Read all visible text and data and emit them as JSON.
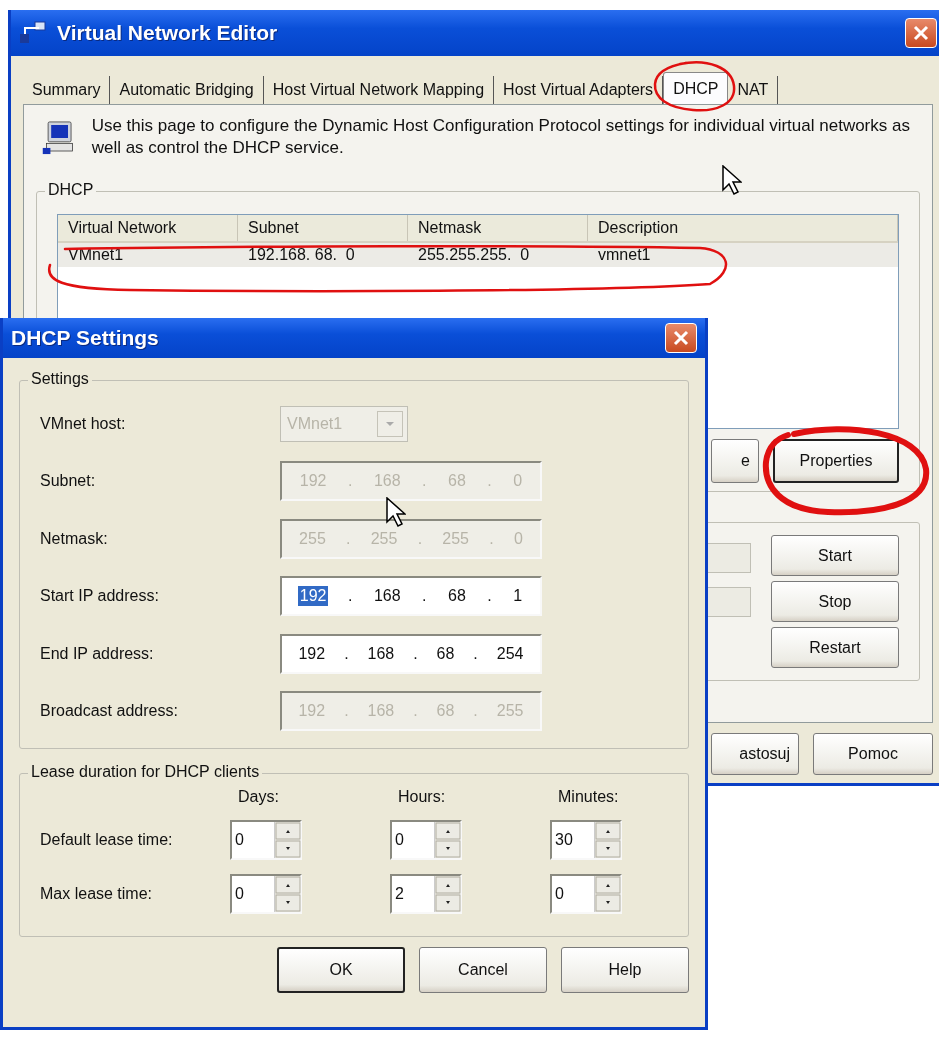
{
  "main_window": {
    "title": "Virtual Network Editor",
    "tabs": [
      {
        "label": "Summary",
        "selected": false
      },
      {
        "label": "Automatic Bridging",
        "selected": false
      },
      {
        "label": "Host Virtual Network Mapping",
        "selected": false
      },
      {
        "label": "Host Virtual Adapters",
        "selected": false
      },
      {
        "label": "DHCP",
        "selected": true
      },
      {
        "label": "NAT",
        "selected": false
      }
    ],
    "description": "Use this page to configure the Dynamic Host Configuration Protocol settings for individual virtual networks as well as control the DHCP service.",
    "group_label": "DHCP",
    "table": {
      "columns": [
        "Virtual Network",
        "Subnet",
        "Netmask",
        "Description"
      ],
      "rows": [
        {
          "cells": [
            "VMnet1",
            "192.168. 68.  0",
            "255.255.255.  0",
            "vmnet1"
          ],
          "selected": true
        }
      ]
    },
    "group_buttons": [
      "e",
      "Properties"
    ],
    "service_buttons": [
      "Start",
      "Stop",
      "Restart"
    ],
    "footer_buttons": [
      "astosuj",
      "Pomoc"
    ]
  },
  "dialog": {
    "title": "DHCP Settings",
    "settings_group": "Settings",
    "host": {
      "label": "VMnet host:",
      "value": "VMnet1",
      "disabled": true
    },
    "fields": [
      {
        "label": "Subnet:",
        "disabled": true,
        "parts": [
          {
            "kind": "octet",
            "text": "192",
            "selected": false
          },
          {
            "kind": "dot",
            "text": "."
          },
          {
            "kind": "octet",
            "text": "168",
            "selected": false
          },
          {
            "kind": "dot",
            "text": "."
          },
          {
            "kind": "octet",
            "text": "68",
            "selected": false
          },
          {
            "kind": "dot",
            "text": "."
          },
          {
            "kind": "octet",
            "text": "0",
            "selected": false
          }
        ]
      },
      {
        "label": "Netmask:",
        "disabled": true,
        "parts": [
          {
            "kind": "octet",
            "text": "255",
            "selected": false
          },
          {
            "kind": "dot",
            "text": "."
          },
          {
            "kind": "octet",
            "text": "255",
            "selected": false
          },
          {
            "kind": "dot",
            "text": "."
          },
          {
            "kind": "octet",
            "text": "255",
            "selected": false
          },
          {
            "kind": "dot",
            "text": "."
          },
          {
            "kind": "octet",
            "text": "0",
            "selected": false
          }
        ]
      },
      {
        "label": "Start IP address:",
        "disabled": false,
        "parts": [
          {
            "kind": "octet",
            "text": "192",
            "selected": true
          },
          {
            "kind": "dot",
            "text": "."
          },
          {
            "kind": "octet",
            "text": "168",
            "selected": false
          },
          {
            "kind": "dot",
            "text": "."
          },
          {
            "kind": "octet",
            "text": "68",
            "selected": false
          },
          {
            "kind": "dot",
            "text": "."
          },
          {
            "kind": "octet",
            "text": "1",
            "selected": false
          }
        ]
      },
      {
        "label": "End IP address:",
        "disabled": false,
        "parts": [
          {
            "kind": "octet",
            "text": "192",
            "selected": false
          },
          {
            "kind": "dot",
            "text": "."
          },
          {
            "kind": "octet",
            "text": "168",
            "selected": false
          },
          {
            "kind": "dot",
            "text": "."
          },
          {
            "kind": "octet",
            "text": "68",
            "selected": false
          },
          {
            "kind": "dot",
            "text": "."
          },
          {
            "kind": "octet",
            "text": "254",
            "selected": false
          }
        ]
      },
      {
        "label": "Broadcast address:",
        "disabled": true,
        "parts": [
          {
            "kind": "octet",
            "text": "192",
            "selected": false
          },
          {
            "kind": "dot",
            "text": "."
          },
          {
            "kind": "octet",
            "text": "168",
            "selected": false
          },
          {
            "kind": "dot",
            "text": "."
          },
          {
            "kind": "octet",
            "text": "68",
            "selected": false
          },
          {
            "kind": "dot",
            "text": "."
          },
          {
            "kind": "octet",
            "text": "255",
            "selected": false
          }
        ]
      }
    ],
    "lease_group": {
      "title": "Lease duration for DHCP clients",
      "columns": [
        "Days:",
        "Hours:",
        "Minutes:"
      ],
      "rows": [
        {
          "label": "Default lease time:",
          "values": [
            "0",
            "0",
            "30"
          ]
        },
        {
          "label": "Max lease time:",
          "values": [
            "0",
            "2",
            "0"
          ]
        }
      ]
    },
    "buttons": [
      {
        "label": "OK",
        "default": true
      },
      {
        "label": "Cancel",
        "default": false
      },
      {
        "label": "Help",
        "default": false
      }
    ]
  }
}
